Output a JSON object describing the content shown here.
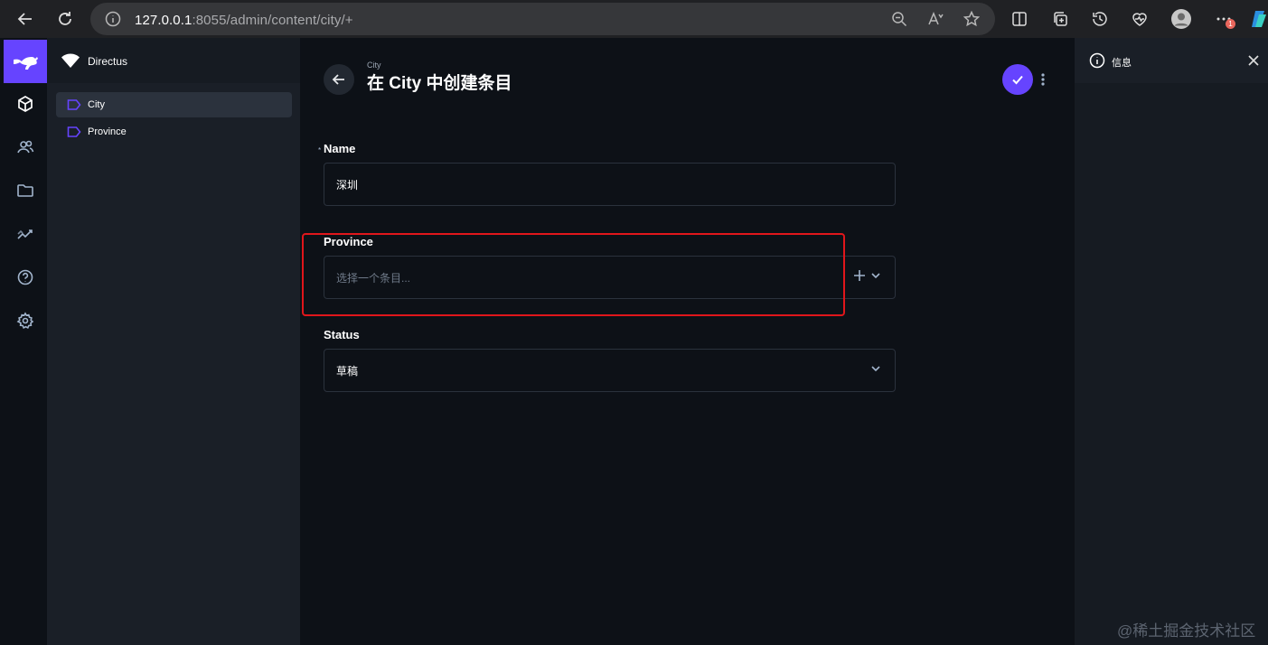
{
  "browser": {
    "url_host": "127.0.0.1",
    "url_path": ":8055/admin/content/city/+",
    "notification_count": "1"
  },
  "project": {
    "name": "Directus"
  },
  "navigation": {
    "items": [
      {
        "label": "City",
        "active": true
      },
      {
        "label": "Province",
        "active": false
      }
    ]
  },
  "header": {
    "breadcrumb": "City",
    "title": "在 City 中创建条目"
  },
  "form": {
    "name": {
      "label": "Name",
      "required_mark": "*",
      "value": "深圳"
    },
    "province": {
      "label": "Province",
      "placeholder": "选择一个条目..."
    },
    "status": {
      "label": "Status",
      "value": "草稿"
    }
  },
  "sidebar": {
    "title": "信息"
  },
  "watermark": "@稀土掘金技术社区",
  "colors": {
    "accent": "#6644ff",
    "highlight": "#e0161b"
  }
}
